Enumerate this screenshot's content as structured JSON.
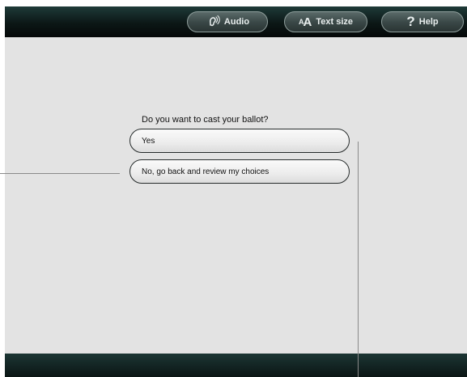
{
  "toolbar": {
    "audio_label": "Audio",
    "text_size_label": "Text size",
    "text_size_icon_small": "A",
    "text_size_icon_big": "A",
    "help_label": "Help",
    "help_icon": "?"
  },
  "ballot": {
    "question": "Do you want to cast your ballot?",
    "options": [
      {
        "label": "Yes"
      },
      {
        "label": "No, go back and review my choices"
      }
    ]
  },
  "colors": {
    "bar_dark": "#0c1716",
    "panel_bg": "#e3e3e3",
    "button_border": "#262b2b"
  },
  "icons": {
    "audio": "audio-ear-icon",
    "help": "question-mark-icon"
  }
}
